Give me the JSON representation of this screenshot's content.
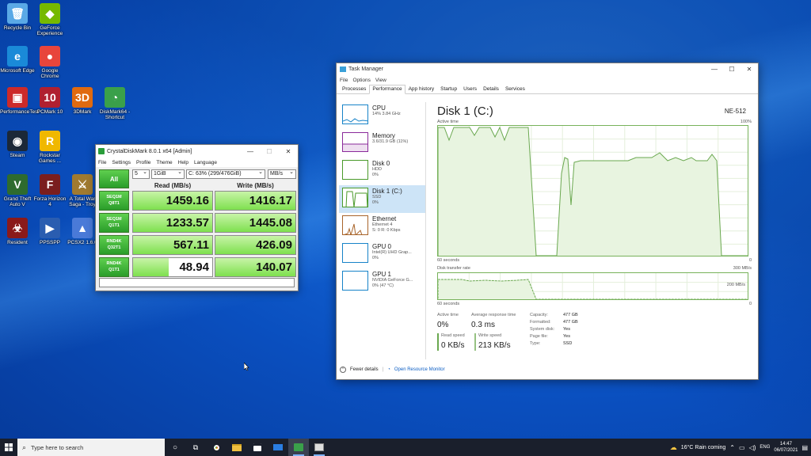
{
  "desktop": {
    "icons": [
      {
        "label": "Recycle Bin",
        "glyph": "🗑",
        "color": "#5aa9e6"
      },
      {
        "label": "GeForce Experience",
        "glyph": "◆",
        "color": "#76b900"
      },
      {
        "label": "Microsoft Edge",
        "glyph": "e",
        "color": "#1a8ad8"
      },
      {
        "label": "Google Chrome",
        "glyph": "●",
        "color": "#e8453c"
      },
      {
        "label": "PerformanceTest",
        "glyph": "▣",
        "color": "#cc2a2a"
      },
      {
        "label": "PCMark 10",
        "glyph": "10",
        "color": "#b02030"
      },
      {
        "label": "3DMark",
        "glyph": "3D",
        "color": "#e06a10"
      },
      {
        "label": "DiskMark64 - Shortcut",
        "glyph": "◔",
        "color": "#3aa04a"
      },
      {
        "label": "Steam",
        "glyph": "◉",
        "color": "#1b2838"
      },
      {
        "label": "Rockstar Games ...",
        "glyph": "R",
        "color": "#f0b800"
      },
      {
        "label": "Grand Theft Auto V",
        "glyph": "V",
        "color": "#2e6b2e"
      },
      {
        "label": "Forza Horizon 4",
        "glyph": "F",
        "color": "#7a1e1e"
      },
      {
        "label": "A Total War Saga - Troy",
        "glyph": "⚔",
        "color": "#a07a30"
      },
      {
        "label": "Resident",
        "glyph": "☣",
        "color": "#8a1a1a"
      },
      {
        "label": "PPSSPP",
        "glyph": "▶",
        "color": "#2a5db0"
      },
      {
        "label": "PCSX2 1.6.0",
        "glyph": "▲",
        "color": "#4a7ad8"
      }
    ]
  },
  "cdm": {
    "title": "CrystalDiskMark 8.0.1 x64 [Admin]",
    "menu": [
      "File",
      "Settings",
      "Profile",
      "Theme",
      "Help",
      "Language"
    ],
    "all_label": "All",
    "count": "5",
    "size": "1GiB",
    "drive": "C: 63% (299/476GiB)",
    "unit": "MB/s",
    "read_header": "Read (MB/s)",
    "write_header": "Write (MB/s)",
    "rows": [
      {
        "l1": "SEQ1M",
        "l2": "Q8T1",
        "read": "1459.16",
        "write": "1416.17",
        "read_frac": 1.0,
        "write_frac": 1.0
      },
      {
        "l1": "SEQ1M",
        "l2": "Q1T1",
        "read": "1233.57",
        "write": "1445.08",
        "read_frac": 1.0,
        "write_frac": 1.0
      },
      {
        "l1": "RND4K",
        "l2": "Q32T1",
        "read": "567.11",
        "write": "426.09",
        "read_frac": 1.0,
        "write_frac": 1.0
      },
      {
        "l1": "RND4K",
        "l2": "Q1T1",
        "read": "48.94",
        "write": "140.07",
        "read_frac": 0.45,
        "write_frac": 1.0
      }
    ]
  },
  "tm": {
    "title": "Task Manager",
    "menu": [
      "File",
      "Options",
      "View"
    ],
    "tabs": [
      "Processes",
      "Performance",
      "App history",
      "Startup",
      "Users",
      "Details",
      "Services"
    ],
    "active_tab": "Performance",
    "sidebar": [
      {
        "name": "CPU",
        "s1": "14% 3.84 GHz",
        "s2": "",
        "color": "#1783c8"
      },
      {
        "name": "Memory",
        "s1": "3.6/31.9 GB (11%)",
        "s2": "",
        "color": "#8a2a9a"
      },
      {
        "name": "Disk 0",
        "s1": "HDD",
        "s2": "0%",
        "color": "#4a9a2a"
      },
      {
        "name": "Disk 1 (C:)",
        "s1": "SSD",
        "s2": "0%",
        "color": "#4a9a2a"
      },
      {
        "name": "Ethernet",
        "s1": "Ethernet 4",
        "s2": "S: 0 R: 0 Kbps",
        "color": "#a8642a"
      },
      {
        "name": "GPU 0",
        "s1": "Intel(R) UHD Grap...",
        "s2": "0%",
        "color": "#1783c8"
      },
      {
        "name": "GPU 1",
        "s1": "NVIDIA GeForce G...",
        "s2": "0% (47 °C)",
        "color": "#1783c8"
      }
    ],
    "disk_title": "Disk 1 (C:)",
    "model": "NE-512",
    "active_time_label": "Active time",
    "pct_100": "100%",
    "sixty_seconds": "60 seconds",
    "zero": "0",
    "transfer_label": "Disk transfer rate",
    "transfer_max": "300 MB/s",
    "transfer_mid": "200 MB/s",
    "stats": {
      "active_time_k": "Active time",
      "active_time_v": "0%",
      "resp_k": "Average response time",
      "resp_v": "0.3 ms",
      "read_k": "Read speed",
      "read_v": "0 KB/s",
      "write_k": "Write speed",
      "write_v": "213 KB/s"
    },
    "props": [
      {
        "k": "Capacity:",
        "v": "477 GB"
      },
      {
        "k": "Formatted:",
        "v": "477 GB"
      },
      {
        "k": "System disk:",
        "v": "Yes"
      },
      {
        "k": "Page file:",
        "v": "Yes"
      },
      {
        "k": "Type:",
        "v": "SSD"
      }
    ],
    "fewer_details": "Fewer details",
    "open_monitor": "Open Resource Monitor"
  },
  "taskbar": {
    "search_placeholder": "Type here to search",
    "weather": "16°C  Rain coming",
    "lang": "ENG",
    "time": "14:47",
    "date": "06/07/2021"
  }
}
